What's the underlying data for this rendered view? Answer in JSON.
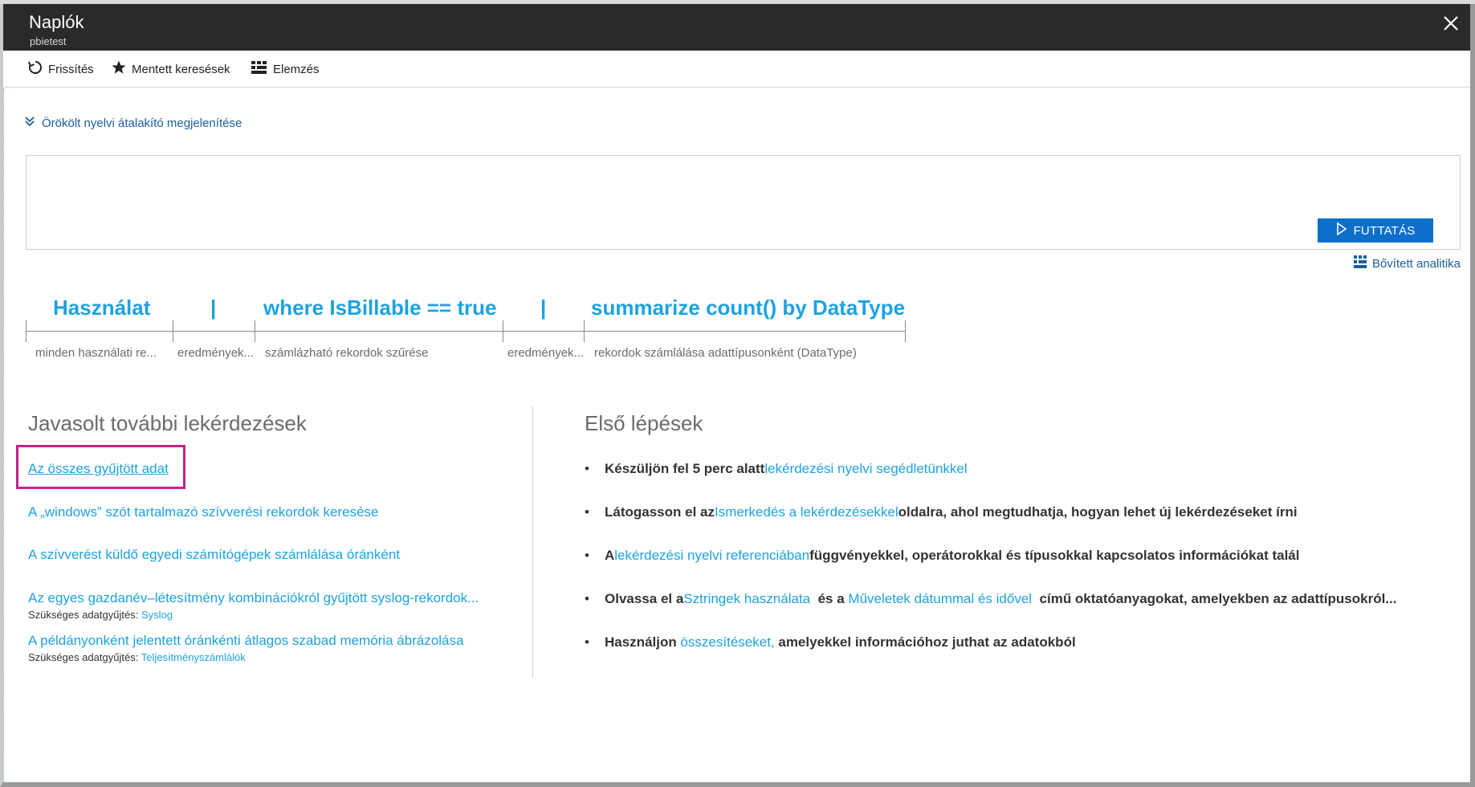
{
  "window": {
    "title": "Naplók",
    "subtitle": "pbietest",
    "close_icon": "close-icon"
  },
  "toolbar": {
    "refresh_label": "Frissítés",
    "saved_searches_label": "Mentett keresések",
    "analytics_label": "Elemzés"
  },
  "legacy_toggle": {
    "label": "Örökölt nyelvi átalakító megjelenítése"
  },
  "editor": {
    "value": "",
    "run_label": "FUTTATÁS"
  },
  "advanced_analytics": {
    "label": "Bővített analitika"
  },
  "query_breakdown": {
    "tokens": [
      {
        "text": "Használat",
        "desc": "minden használati re..."
      },
      {
        "text": "|",
        "desc": "eredmények..."
      },
      {
        "text": "where IsBillable == true",
        "desc": "számlázható rekordok szűrése"
      },
      {
        "text": "|",
        "desc": "eredmények..."
      },
      {
        "text": "summarize count() by DataType",
        "desc": "rekordok számlálása adattípusonként (DataType)"
      }
    ]
  },
  "suggested": {
    "title": "Javasolt további lekérdezések",
    "items": [
      {
        "label": "Az összes gyűjtött adat"
      },
      {
        "label": "A „windows” szót tartalmazó szívverési rekordok keresése"
      },
      {
        "label": "A szívverést küldő egyedi számítógépek számlálása óránként"
      },
      {
        "label": "Az egyes gazdanév–létesítmény kombinációkról gyűjtött syslog-rekordok...",
        "req_prefix": "Szükséges adatgyűjtés:",
        "req_link": "Syslog"
      },
      {
        "label": "A példányonként jelentett óránkénti átlagos szabad memória ábrázolása",
        "req_prefix": "Szükséges adatgyűjtés:",
        "req_link": "Teljesítményszámlálók"
      }
    ]
  },
  "getting_started": {
    "title": "Első lépések",
    "bullet": "•",
    "steps": [
      {
        "pre": "Készüljön fel 5 perc alatt ",
        "link": "lekérdezési nyelvi segédletünkkel",
        "post": ""
      },
      {
        "pre": "Látogasson el az ",
        "link": "Ismerkedés a lekérdezésekkel",
        "post": " oldalra, ahol megtudhatja, hogyan lehet új lekérdezéseket írni"
      },
      {
        "pre": "A ",
        "link": "lekérdezési nyelvi referenciában",
        "post": " függvényekkel, operátorokkal és típusokkal kapcsolatos információkat talál"
      },
      {
        "pre": "Olvassa el a ",
        "link": "Sztringek használata",
        "mid": "  és a ",
        "link2": "Műveletek dátummal és idővel",
        "post": "  című oktatóanyagokat, amelyekben az adattípusokról..."
      },
      {
        "pre": "Használjon ",
        "link": "összesítéseket,",
        "post": " amelyekkel információhoz juthat az adatokból"
      }
    ]
  }
}
